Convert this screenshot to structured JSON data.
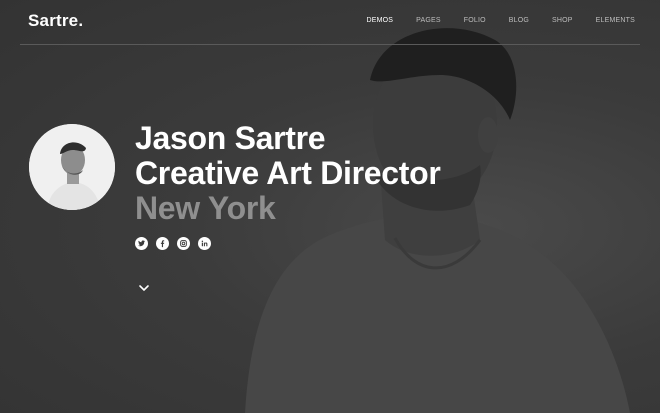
{
  "brand": {
    "logo_text": "Sartre."
  },
  "nav": {
    "items": [
      {
        "label": "DEMOS",
        "active": true
      },
      {
        "label": "PAGES",
        "active": false
      },
      {
        "label": "FOLIO",
        "active": false
      },
      {
        "label": "BLOG",
        "active": false
      },
      {
        "label": "SHOP",
        "active": false
      },
      {
        "label": "ELEMENTS",
        "active": false
      }
    ]
  },
  "hero": {
    "name": "Jason Sartre",
    "role": "Creative Art Director",
    "location": "New York"
  },
  "socials": [
    {
      "icon": "twitter-icon"
    },
    {
      "icon": "facebook-icon"
    },
    {
      "icon": "instagram-icon"
    },
    {
      "icon": "linkedin-icon"
    }
  ],
  "colors": {
    "background": "#3a3a3a",
    "text_primary": "#ffffff",
    "text_muted": "#8f8f8f",
    "nav_text": "#bdbdbd"
  }
}
